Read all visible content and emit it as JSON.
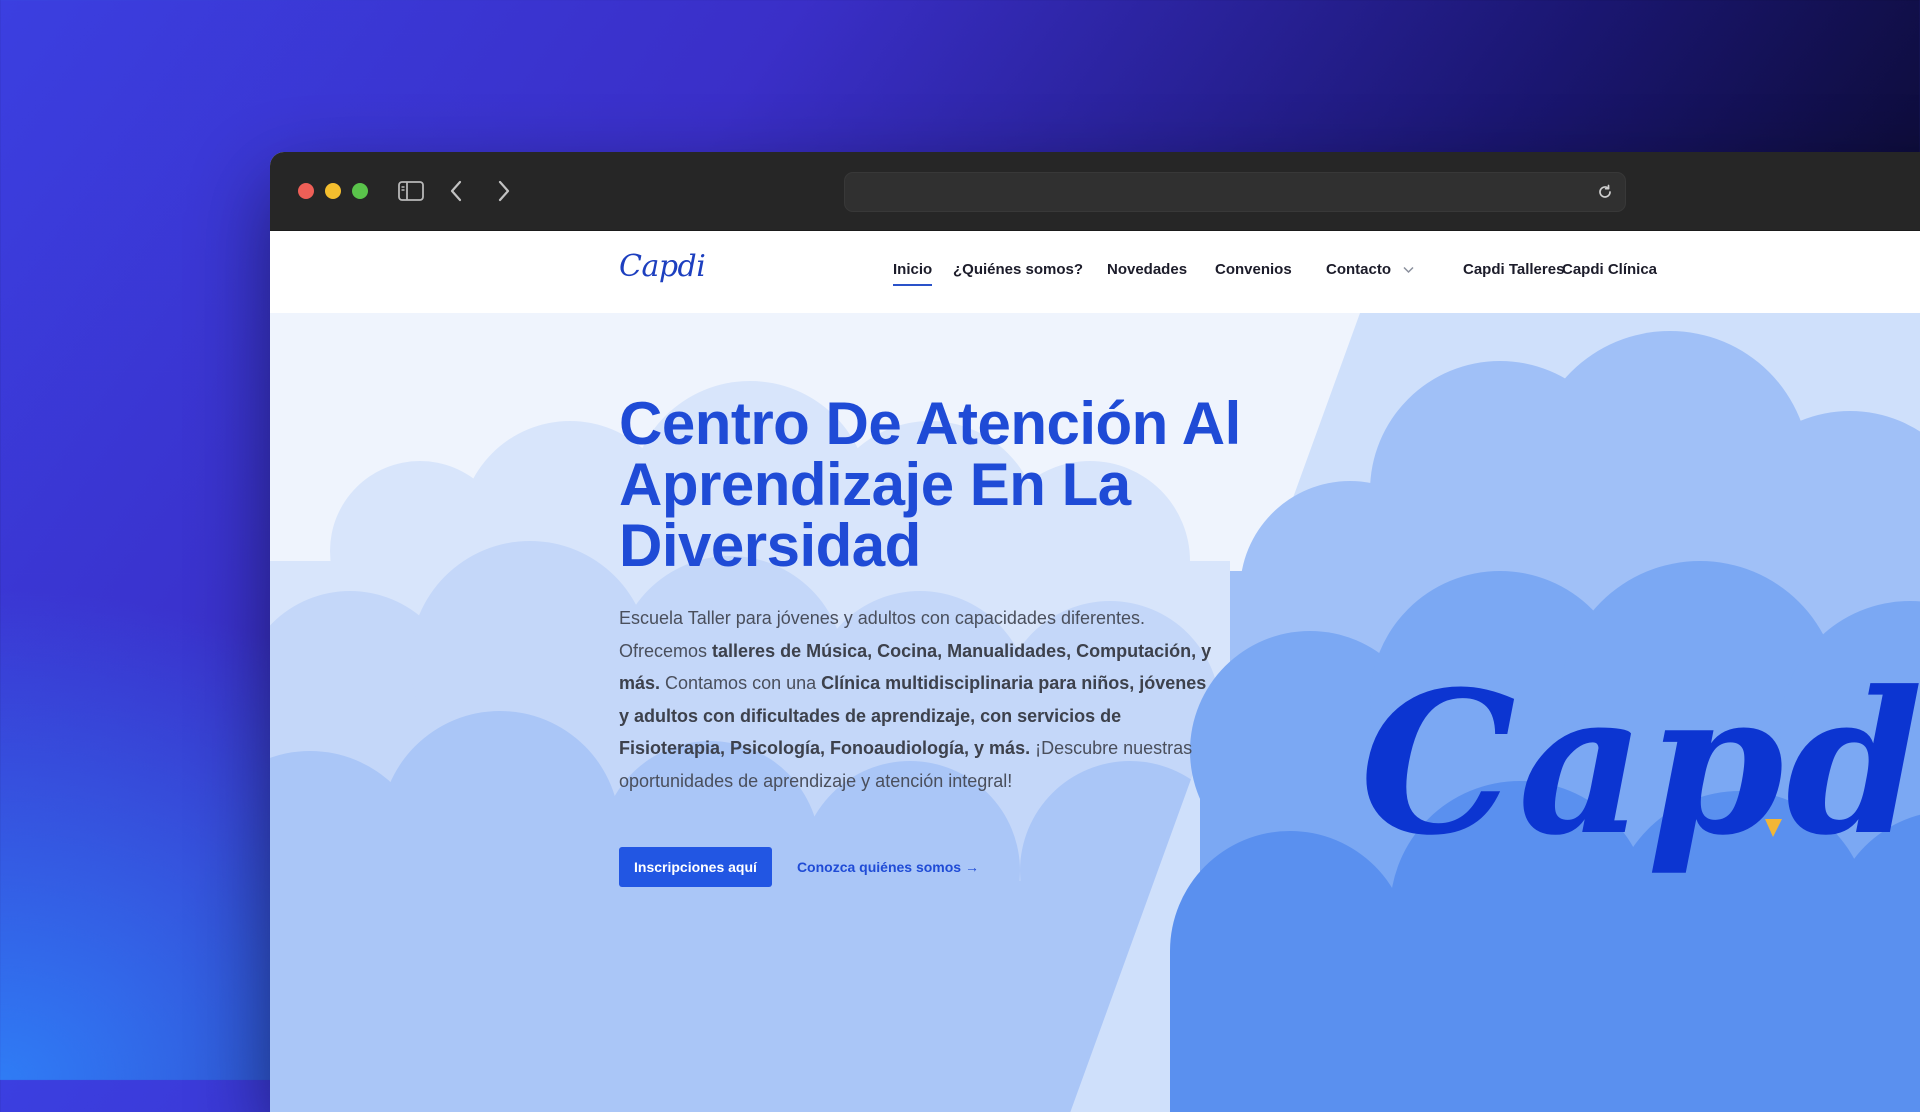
{
  "browser": {
    "url": "",
    "icons": [
      "sidebar-icon",
      "chevron-left-icon",
      "chevron-right-icon",
      "reload-icon"
    ]
  },
  "nav": {
    "logo": "Capdi",
    "items": [
      {
        "label": "Inicio",
        "active": true
      },
      {
        "label": "¿Quiénes somos?"
      },
      {
        "label": "Novedades"
      },
      {
        "label": "Convenios"
      },
      {
        "label": "Contacto",
        "dropdown": true
      },
      {
        "label": "Capdi Talleres"
      },
      {
        "label": "Capdi Clínica"
      }
    ]
  },
  "hero": {
    "title": "Centro De Atención Al Aprendizaje En La Diversidad",
    "desc": {
      "p1": "Escuela Taller para jóvenes y adultos con capacidades diferentes. Ofrecemos ",
      "b1": "talleres de Música, Cocina, Manualidades, Computación, y más.",
      "p2": " Contamos con una ",
      "b2": "Clínica multidisciplinaria para niños, jóvenes y adultos con dificultades de aprendizaje, con servicios de Fisioterapia, Psicología, Fonoaudiología, y más.",
      "p3": " ¡Descubre nuestras oportunidades de aprendizaje y atención integral!"
    },
    "primary_cta": "Inscripciones aquí",
    "secondary_cta": "Conozca quiénes somos →"
  },
  "brand_logo": "Capdi",
  "colors": {
    "accent": "#1f4bd6",
    "button": "#2256e3",
    "logo": "#0c35d1",
    "pencil_tip": "#f2b636"
  }
}
